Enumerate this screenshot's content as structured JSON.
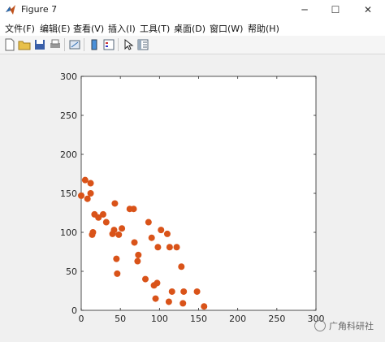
{
  "window": {
    "title": "Figure 7",
    "controls": {
      "minimize": "─",
      "maximize": "☐",
      "close": "✕"
    }
  },
  "menu": [
    "文件(F)",
    "编辑(E)",
    "查看(V)",
    "插入(I)",
    "工具(T)",
    "桌面(D)",
    "窗口(W)",
    "帮助(H)"
  ],
  "toolbar_icons": [
    "new-file-icon",
    "open-folder-icon",
    "save-icon",
    "print-icon",
    "link-plot-icon",
    "insert-colorbar-icon",
    "insert-legend-icon",
    "edit-pointer-icon",
    "property-inspector-icon"
  ],
  "chart_data": {
    "type": "scatter",
    "xlim": [
      0,
      300
    ],
    "ylim": [
      0,
      300
    ],
    "xticks": [
      0,
      50,
      100,
      150,
      200,
      250,
      300
    ],
    "yticks": [
      0,
      50,
      100,
      150,
      200,
      250,
      300
    ],
    "marker_color": "#D95319",
    "grid": false,
    "points": [
      [
        0,
        147
      ],
      [
        5,
        167
      ],
      [
        8,
        143
      ],
      [
        12,
        163
      ],
      [
        12,
        150
      ],
      [
        14,
        97
      ],
      [
        15,
        100
      ],
      [
        17,
        123
      ],
      [
        22,
        119
      ],
      [
        28,
        123
      ],
      [
        32,
        113
      ],
      [
        40,
        98
      ],
      [
        42,
        103
      ],
      [
        43,
        137
      ],
      [
        45,
        66
      ],
      [
        46,
        47
      ],
      [
        48,
        97
      ],
      [
        52,
        105
      ],
      [
        62,
        130
      ],
      [
        67,
        130
      ],
      [
        68,
        87
      ],
      [
        72,
        63
      ],
      [
        73,
        71
      ],
      [
        82,
        40
      ],
      [
        86,
        113
      ],
      [
        90,
        93
      ],
      [
        93,
        32
      ],
      [
        95,
        15
      ],
      [
        97,
        35
      ],
      [
        98,
        81
      ],
      [
        102,
        103
      ],
      [
        110,
        98
      ],
      [
        112,
        11
      ],
      [
        113,
        81
      ],
      [
        116,
        24
      ],
      [
        122,
        81
      ],
      [
        128,
        56
      ],
      [
        130,
        9
      ],
      [
        131,
        24
      ],
      [
        148,
        24
      ],
      [
        157,
        5
      ]
    ]
  },
  "watermark": "广角科研社"
}
